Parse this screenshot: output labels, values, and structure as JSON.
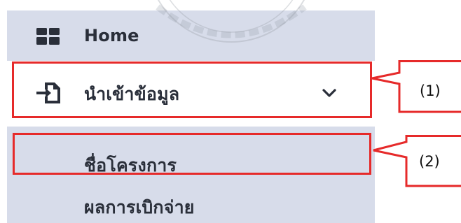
{
  "sidebar": {
    "items": [
      {
        "label": "Home",
        "icon": "grid-icon"
      },
      {
        "label": "นำเข้าข้อมูล",
        "icon": "import-file-icon",
        "chevron": "chevron-down-icon"
      }
    ],
    "subitems": [
      {
        "label": "ชื่อโครงการ"
      },
      {
        "label": "ผลการเบิกจ่าย"
      }
    ]
  },
  "annotations": [
    {
      "label": "(1)"
    },
    {
      "label": "(2)"
    }
  ],
  "colors": {
    "sidebar_bg": "#d7dcea",
    "highlight": "#e62a2a",
    "text": "#2a2f3a"
  }
}
